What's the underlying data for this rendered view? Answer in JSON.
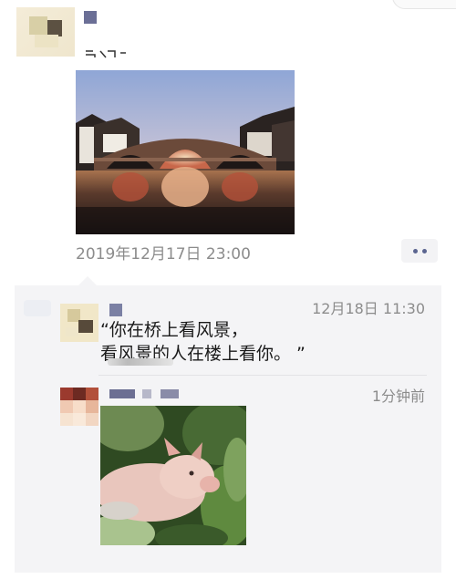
{
  "moment": {
    "time": "2019年12月17日 23:00"
  },
  "comments": [
    {
      "time": "12月18日 11:30",
      "quote_lines": [
        "“你在桥上看风景，",
        "看风景的人在楼上看你。 ”"
      ]
    },
    {
      "time": "1分钟前"
    }
  ],
  "colors": {
    "time_gray": "#8c8c8c",
    "link_blue": "#5b6590",
    "panel_bg": "#f4f4f6"
  },
  "icons": {
    "more": "more-dots-icon"
  }
}
